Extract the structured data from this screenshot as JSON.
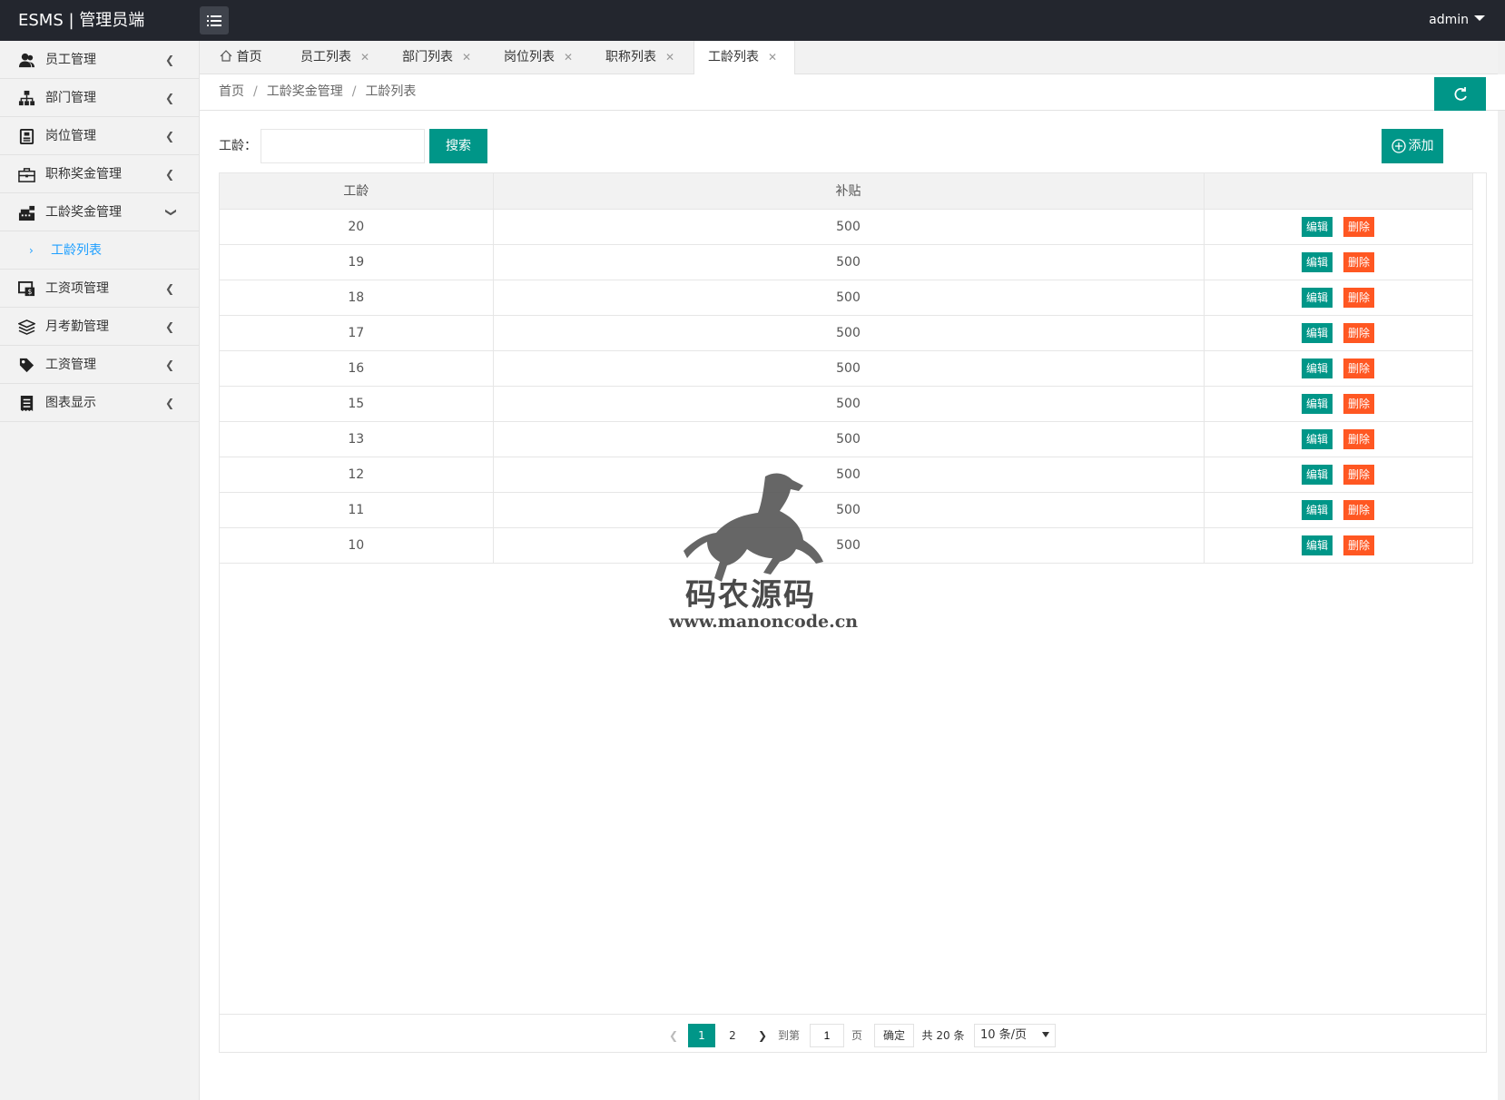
{
  "app": {
    "title": "ESMS | 管理员端",
    "user": "admin"
  },
  "sidebar": {
    "items": [
      {
        "label": "员工管理",
        "icon": "users-icon"
      },
      {
        "label": "部门管理",
        "icon": "sitemap-icon"
      },
      {
        "label": "岗位管理",
        "icon": "id-card-icon"
      },
      {
        "label": "职称奖金管理",
        "icon": "briefcase-icon"
      },
      {
        "label": "工龄奖金管理",
        "icon": "cash-register-icon",
        "expanded": true,
        "sub": "工龄列表"
      },
      {
        "label": "工资项管理",
        "icon": "money-screen-icon"
      },
      {
        "label": "月考勤管理",
        "icon": "layers-icon"
      },
      {
        "label": "工资管理",
        "icon": "tag-icon"
      },
      {
        "label": "图表显示",
        "icon": "receipt-icon"
      }
    ]
  },
  "tabs": [
    {
      "label": "首页",
      "icon": "home-icon"
    },
    {
      "label": "员工列表"
    },
    {
      "label": "部门列表"
    },
    {
      "label": "岗位列表"
    },
    {
      "label": "职称列表"
    },
    {
      "label": "工龄列表",
      "active": true
    }
  ],
  "breadcrumb": [
    "首页",
    "工龄奖金管理",
    "工龄列表"
  ],
  "search": {
    "label": "工龄：",
    "value": "",
    "button": "搜索"
  },
  "add_button": "添加",
  "table": {
    "headers": [
      "工龄",
      "补贴",
      ""
    ],
    "rows": [
      {
        "years": "20",
        "subsidy": "500"
      },
      {
        "years": "19",
        "subsidy": "500"
      },
      {
        "years": "18",
        "subsidy": "500"
      },
      {
        "years": "17",
        "subsidy": "500"
      },
      {
        "years": "16",
        "subsidy": "500"
      },
      {
        "years": "15",
        "subsidy": "500"
      },
      {
        "years": "13",
        "subsidy": "500"
      },
      {
        "years": "12",
        "subsidy": "500"
      },
      {
        "years": "11",
        "subsidy": "500"
      },
      {
        "years": "10",
        "subsidy": "500"
      }
    ],
    "edit_label": "编辑",
    "delete_label": "删除"
  },
  "pagination": {
    "current": "1",
    "page2": "2",
    "goto_label": "到第",
    "goto_value": "1",
    "page_label": "页",
    "confirm": "确定",
    "total": "共 20 条",
    "page_size": "10 条/页"
  },
  "watermark": {
    "title": "码农源码",
    "url": "www.manoncode.cn"
  },
  "colors": {
    "header": "#23262e",
    "primary": "#009688",
    "danger": "#ff5722",
    "link": "#1e9fff"
  }
}
